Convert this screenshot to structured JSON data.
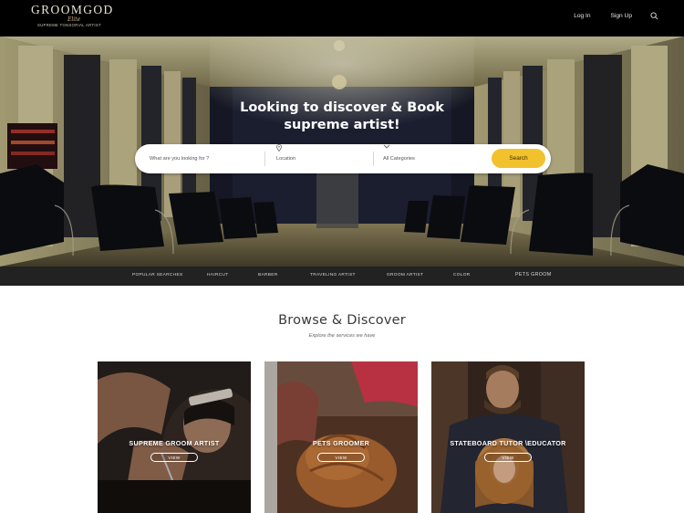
{
  "brand": {
    "name": "GROOMGOD",
    "script": "Elite",
    "tagline": "SUPREME TONSORIAL ARTIST"
  },
  "nav": {
    "login": "Log In",
    "signup": "Sign Up",
    "search_icon": "search-icon"
  },
  "hero": {
    "title_line1": "Looking to discover & Book",
    "title_line2": "supreme artist!"
  },
  "search": {
    "what_placeholder": "What are you looking for ?",
    "location_placeholder": "Location",
    "location_icon": "map-pin-icon",
    "category_value": "All Categories",
    "category_icon": "chevron-down-icon",
    "button_label": "Search"
  },
  "categories": [
    "POPULAR SEARCHES",
    "HAIRCUT",
    "BARBER",
    "TRAVELING ARTIST",
    "GROOM ARTIST",
    "COLOR",
    "PETS GROOM"
  ],
  "browse": {
    "title": "Browse & Discover",
    "subtitle": "Explore the services we have"
  },
  "cards": [
    {
      "title": "SUPREME GROOM ARTIST",
      "button": "VIEW"
    },
    {
      "title": "PETS GROOMER",
      "button": "VIEW"
    },
    {
      "title": "STATEBOARD TUTOR \\EDUCATOR",
      "button": "VIEW"
    }
  ],
  "colors": {
    "header_bg": "#000000",
    "strip_bg": "#222222",
    "accent": "#f2c12e"
  }
}
